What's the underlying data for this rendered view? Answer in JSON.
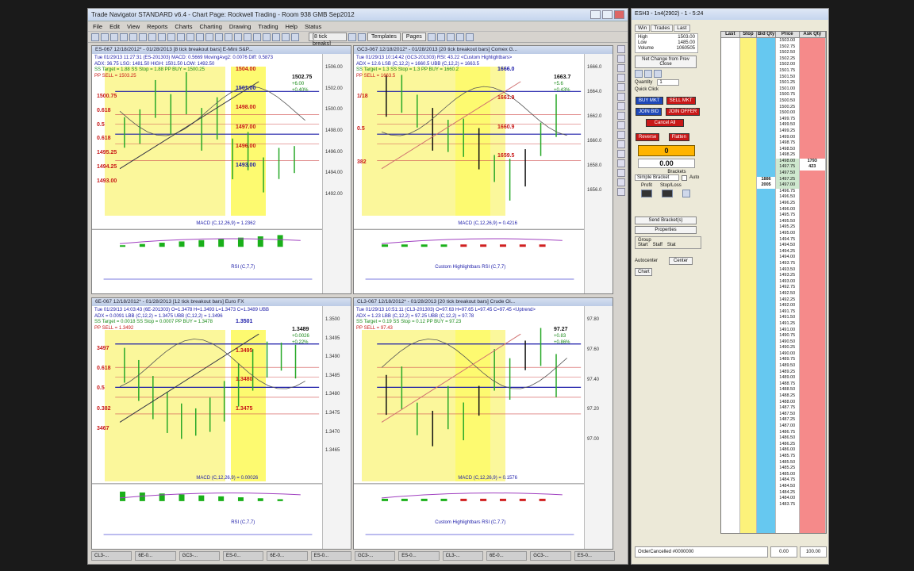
{
  "app": {
    "title": "Trade Navigator STANDARD v6.4  -  Chart Page: Rockwell Trading - Room 938 GMB Sep2012",
    "menu": [
      "File",
      "Edit",
      "View",
      "Reports",
      "Charts",
      "Charting",
      "Drawing",
      "Trading",
      "Help",
      "Status"
    ],
    "toolbar_combo": "[8 tick breaks]",
    "toolbar_buttons": [
      "Templates",
      "Pages"
    ]
  },
  "charts": [
    {
      "id": "es",
      "title": "ES-067  12/18/2012* - 01/28/2013  [8 tick breakout bars]  E-Mini S&P...",
      "info": [
        {
          "cls": "b",
          "text": "Tue  01/29/13 11:27:31 (ES-201303) MACD: 0.5669  MovingAvg2: 0.0076  Diff: 0.5873"
        },
        {
          "cls": "b",
          "text": "ADX: 36.75  LSG: 1481.50  HIGH: 1501.50  LOW: 1492.50"
        },
        {
          "cls": "g",
          "text": "SS Target = 1.88   SS Stop = 1.88   PP BUY = 1500.25"
        },
        {
          "cls": "r",
          "text": "PP SELL = 1503.25"
        }
      ],
      "last": "1502.75",
      "chg": "+6.00",
      "pct": "+0.40%",
      "ticks": [
        "1506.00",
        "1502.00",
        "1500.00",
        "1498.00",
        "1496.00",
        "1494.00",
        "1492.00"
      ],
      "fibs": [
        {
          "cls": "r",
          "text": "1504.00"
        },
        {
          "cls": "n",
          "text": "1501.00"
        },
        {
          "cls": "r",
          "text": "1498.00"
        },
        {
          "cls": "r",
          "text": "1497.00"
        },
        {
          "cls": "r",
          "text": "1496.00"
        },
        {
          "cls": "n",
          "text": "1493.00"
        }
      ],
      "fib_left": [
        "1500.75",
        "0.618",
        "0.5",
        "0.618",
        "1495.25",
        "1494.25",
        "1493.00"
      ],
      "macd_label": "MACD (C,12,26,9) = 1.2362",
      "rsi_label": "RSI (C,7,7)"
    },
    {
      "id": "gc",
      "title": "GC3-067  12/18/2012* - 01/28/2013  [20 tick breakout bars]  Comex G...",
      "info": [
        {
          "cls": "b",
          "text": "Tue  01/29/13 10:14:42 (GC3-201303) RSI: 43.22  <Custom Highlightbars>"
        },
        {
          "cls": "b",
          "text": "ADX = 12.6   LSB (C,12,2) = 1660.5   UBB (C,12,2) = 1663.5"
        },
        {
          "cls": "g",
          "text": "SS Target = 1.3   SS Stop = 1.3   PP BUY = 1660.2"
        },
        {
          "cls": "r",
          "text": "PP SELL = 1663.5"
        }
      ],
      "last": "1663.7",
      "chg": "+5.6",
      "pct": "+0.43%",
      "ticks": [
        "1666.0",
        "1664.0",
        "1662.0",
        "1660.0",
        "1658.0",
        "1656.0"
      ],
      "fibs": [
        {
          "cls": "n",
          "text": "1666.0"
        },
        {
          "cls": "r",
          "text": "1661.9"
        },
        {
          "cls": "r",
          "text": "1660.9"
        },
        {
          "cls": "r",
          "text": "1659.5"
        }
      ],
      "fib_left": [
        "1/18",
        "0.5",
        "382"
      ],
      "macd_label": "MACD (C,12,26,9) = 0.4216",
      "rsi_label": "Custom Highlightbars   RSI (C,7,7)"
    },
    {
      "id": "6e",
      "title": "6E-067  12/18/2012* - 01/28/2013  [12 tick breakout bars]  Euro FX",
      "info": [
        {
          "cls": "b",
          "text": "Tue  01/29/13 14:03:43 (6E-201303) O=1.3478  H=1.3493  L=1.3473  C=1.3489  UBB"
        },
        {
          "cls": "b",
          "text": "ADX = 0.0091   LBB (C,12,2) = 1.3475   UBB (C,12,2) = 1.3496"
        },
        {
          "cls": "g",
          "text": "SS Target = 0.0018   SS Stop = 0.0007   PP BUY = 1.3478"
        },
        {
          "cls": "r",
          "text": "PP SELL = 1.3492"
        }
      ],
      "last": "1.3489",
      "chg": "+0.0026",
      "pct": "+0.22%",
      "ticks": [
        "1.3500",
        "1.3495",
        "1.3490",
        "1.3485",
        "1.3480",
        "1.3475",
        "1.3470",
        "1.3465"
      ],
      "fibs": [
        {
          "cls": "n",
          "text": "1.3501"
        },
        {
          "cls": "r",
          "text": "1.3495"
        },
        {
          "cls": "r",
          "text": "1.3480"
        },
        {
          "cls": "r",
          "text": "1.3475"
        }
      ],
      "fib_left": [
        "3497",
        "0.618",
        "0.5",
        "0.382",
        "3467"
      ],
      "macd_label": "MACD (C,12,26,9) = 0.00026",
      "rsi_label": "RSI (C,7,7)"
    },
    {
      "id": "cl",
      "title": "CL3-067  12/18/2012* - 01/28/2013  [20 tick breakout bars]  Crude Oi...",
      "info": [
        {
          "cls": "b",
          "text": "Tue  01/29/13 10:51:11 (CL3-201303) O=97.63  H=97.65  L=97.45  C=97.45  <Uptrend>"
        },
        {
          "cls": "b",
          "text": "ADX = 1.23   LBB (C,12,2) = 97.25   UBB (C,12,2) = 97.78"
        },
        {
          "cls": "g",
          "text": "SS Target = 0.19   SS Stop = 0.12   PP BUY = 97.23"
        },
        {
          "cls": "r",
          "text": "PP SELL = 97.43"
        }
      ],
      "last": "97.27",
      "chg": "+0.83",
      "pct": "+0.86%",
      "ticks": [
        "97.80",
        "97.60",
        "97.40",
        "97.20",
        "97.00"
      ],
      "fibs": [],
      "fib_left": [],
      "macd_label": "MACD (C,12,26,9) = 0.1576",
      "rsi_label": "Custom Highlightbars   RSI (C,7,7)"
    }
  ],
  "taskbar": [
    "CL3-...",
    "6E-0...",
    "GC3-...",
    "ES-0...",
    "6E-0...",
    "ES-0...",
    "GC3-...",
    "ES-0...",
    "CL3-...",
    "6E-0...",
    "GC3-...",
    "ES-0..."
  ],
  "dom": {
    "title": "ESH3 - 1n4(2902) - 1 - 5:24",
    "tabs": [
      "Win",
      "Trades",
      "Last"
    ],
    "quote": [
      {
        "label": "High",
        "value": "1503.00"
      },
      {
        "label": "Low",
        "value": "1485.00"
      },
      {
        "label": "Volume",
        "value": "1060505"
      }
    ],
    "net_change_label": "Net Change from Prev Close",
    "quantity_label": "Quantity",
    "quantity_value": "1",
    "quick_click": "Quick Click",
    "buy_mkt": "BUY MKT",
    "sell_mkt": "SELL MKT",
    "join_bid": "JOIN BID",
    "join_offer": "JOIN OFFER",
    "cancel_all": "Cancel All",
    "reverse": "Reverse",
    "flatten": "Flatten",
    "position": "0",
    "pnl": "0.00",
    "brackets_label": "Brackets",
    "bracket_select": "Simple Bracket",
    "auto_label": "Auto",
    "profit_label": "Profit",
    "stop_label": "Stop/Loss",
    "send_bracket": "Send Bracket(s)",
    "properties": "Properties",
    "group_label": "Group",
    "group_options": [
      "Start",
      "Staff",
      "Stat"
    ],
    "autocenter": "Autocenter",
    "center": "Center",
    "chart_btn": "Chart",
    "ladder_headers": [
      "Last",
      "Stop",
      "Bid Qty",
      "Price",
      "Ask Qty"
    ],
    "prices": [
      "1503.00",
      "1502.75",
      "1502.50",
      "1502.25",
      "1502.00",
      "1501.75",
      "1501.50",
      "1501.25",
      "1501.00",
      "1500.75",
      "1500.50",
      "1500.25",
      "1500.00",
      "1499.75",
      "1499.50",
      "1499.25",
      "1499.00",
      "1498.75",
      "1498.50",
      "1498.25",
      "1498.00",
      "1497.75",
      "1497.50",
      "1497.25",
      "1497.00",
      "1496.75",
      "1496.50",
      "1496.25",
      "1496.00",
      "1495.75",
      "1495.50",
      "1495.25",
      "1495.00",
      "1494.75",
      "1494.50",
      "1494.25",
      "1494.00",
      "1493.75",
      "1493.50",
      "1493.25",
      "1493.00",
      "1492.75",
      "1492.50",
      "1492.25",
      "1492.00",
      "1491.75",
      "1491.50",
      "1491.25",
      "1491.00",
      "1490.75",
      "1490.50",
      "1490.25",
      "1490.00",
      "1489.75",
      "1489.50",
      "1489.25",
      "1489.00",
      "1488.75",
      "1488.50",
      "1488.25",
      "1488.00",
      "1487.75",
      "1487.50",
      "1487.25",
      "1487.00",
      "1486.75",
      "1486.50",
      "1486.25",
      "1486.00",
      "1485.75",
      "1485.50",
      "1485.25",
      "1485.00",
      "1484.75",
      "1484.50",
      "1484.25",
      "1484.00",
      "1483.75"
    ],
    "bid_qty_marks": [
      {
        "row": 23,
        "text": "1886"
      },
      {
        "row": 24,
        "text": "2005"
      }
    ],
    "ask_qty_marks": [
      {
        "row": 20,
        "text": "1793"
      },
      {
        "row": 21,
        "text": "423"
      }
    ],
    "status_text": "OrderCancelled #0000000",
    "status_a": "0.00",
    "status_b": "100.00"
  }
}
